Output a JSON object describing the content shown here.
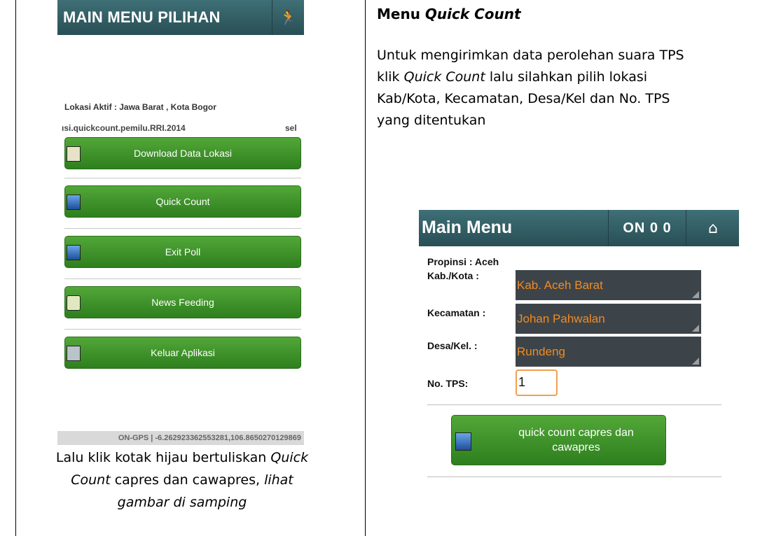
{
  "left_screen": {
    "title": "MAIN MENU PILIHAN",
    "runner_icon": "runner-icon",
    "active_location": "Lokasi Aktif : Jawa Barat , Kota Bogor",
    "package_text": "ısi.quickcount.pemilu.RRI.2014",
    "package_tail": "sel",
    "buttons": [
      {
        "label": "Download Data Lokasi",
        "icon": "location-data-icon"
      },
      {
        "label": "Quick Count",
        "icon": "person-card-icon"
      },
      {
        "label": "Exit Poll",
        "icon": "person-card-icon"
      },
      {
        "label": "News Feeding",
        "icon": "news-can-icon"
      },
      {
        "label": "Keluar Aplikasi",
        "icon": "exit-door-icon"
      }
    ],
    "status": "ON-GPS | -6.262923362553281,106.8650270129869"
  },
  "caption": {
    "line1": "Lalu klik kotak hijau bertuliskan ",
    "line1_italic": "Quick",
    "line2_italic": "Count",
    "line2": " capres dan cawapres, ",
    "line2_italic_b": "lihat",
    "line3_italic": "gambar di samping"
  },
  "right_text": {
    "title_plain": "Menu ",
    "title_italic": "Quick Count",
    "p1": "Untuk mengirimkan data perolehan suara TPS",
    "p2a": "klik ",
    "p2_italic": "Quick Count",
    "p2b": " lalu silahkan pilih lokasi",
    "p3": "Kab/Kota, Kecamatan, Desa/Kel dan No. TPS",
    "p4": "yang ditentukan"
  },
  "right_screen": {
    "title": "Main Menu",
    "status": "ON 0 0",
    "home_icon": "home-icon",
    "propinsi": "Propinsi  : Aceh",
    "kab_label": "Kab./Kota :",
    "kab_value": "Kab. Aceh Barat",
    "kec_label": "Kecamatan :",
    "kec_value": "Johan Pahwalan",
    "desa_label": "Desa/Kel. :",
    "desa_value": "Rundeng",
    "tps_label": "No. TPS:",
    "tps_value": "1",
    "button_label": "quick count capres dan cawapres"
  },
  "colors": {
    "header": "#2f5a60",
    "button_green": "#3f9330",
    "spinner_bg": "#3d4449",
    "spinner_text": "#f08a24"
  }
}
